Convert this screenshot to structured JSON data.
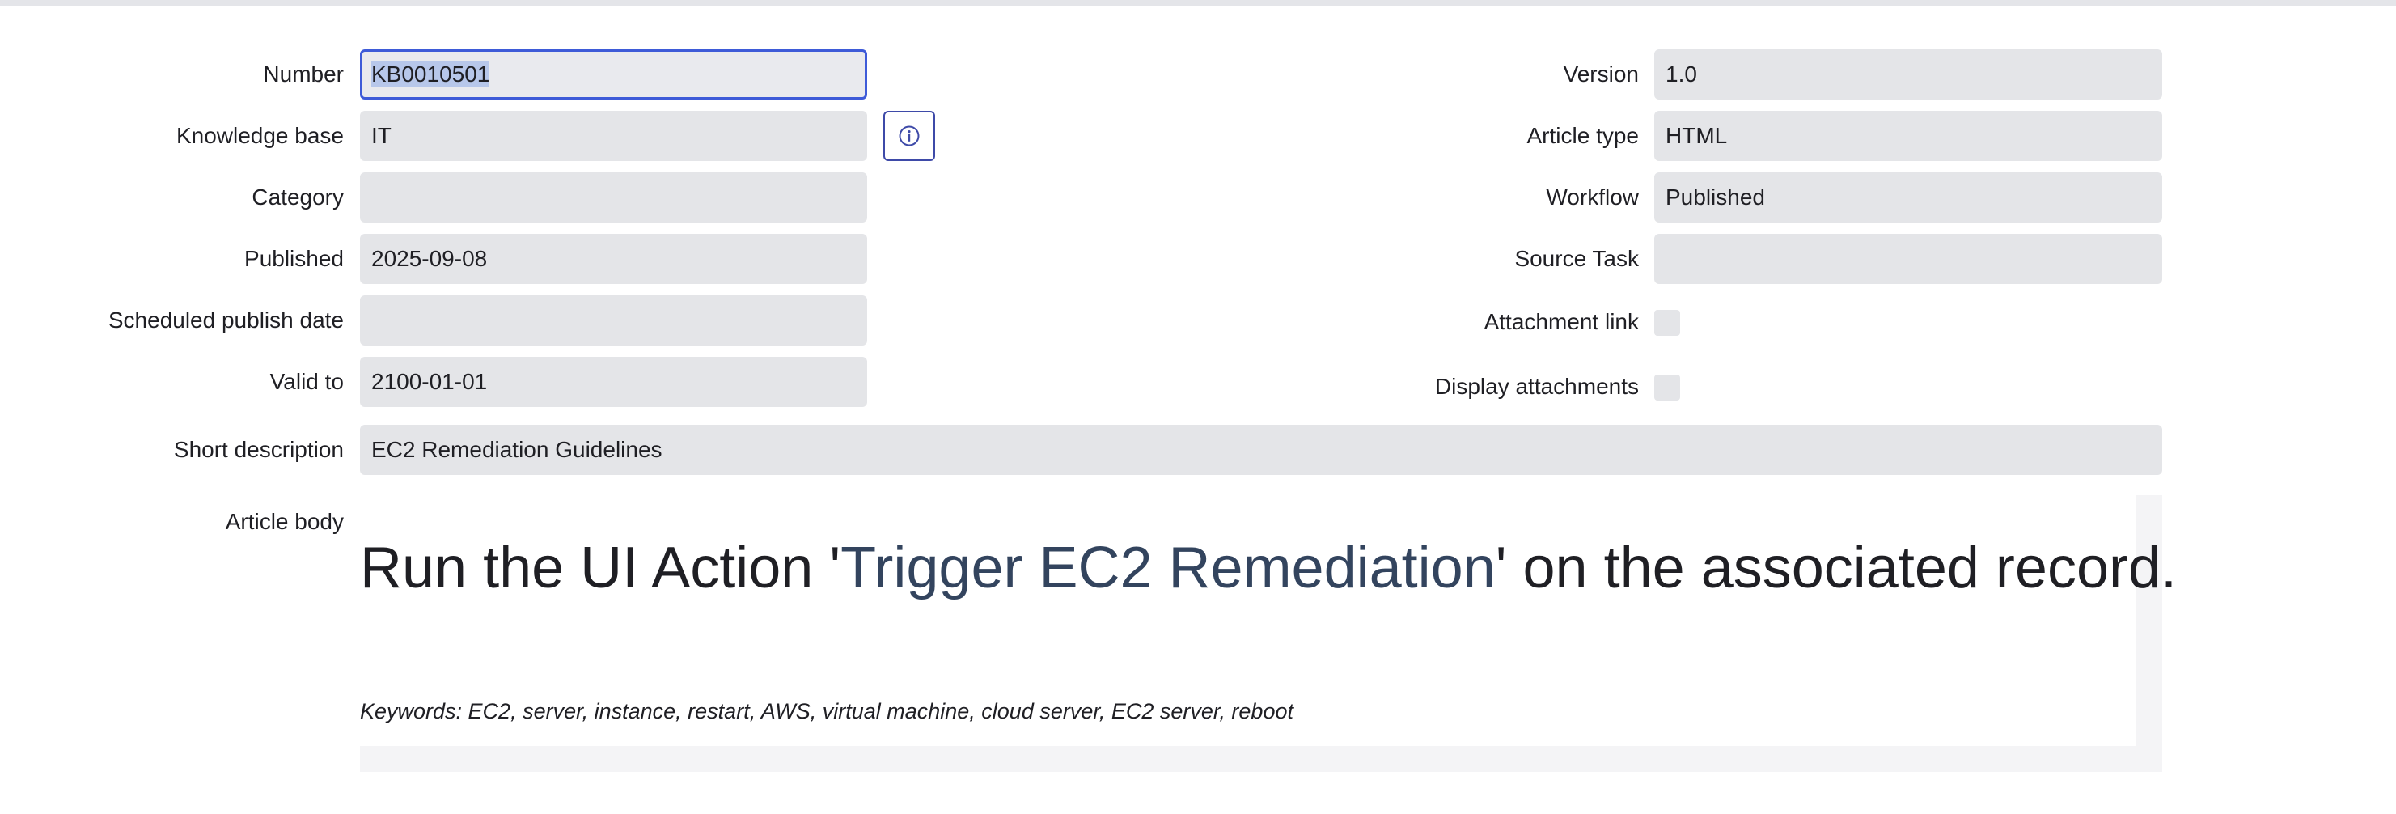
{
  "form": {
    "left": {
      "number": {
        "label": "Number",
        "value": "KB0010501"
      },
      "knowledge_base": {
        "label": "Knowledge base",
        "value": "IT"
      },
      "category": {
        "label": "Category",
        "value": ""
      },
      "published": {
        "label": "Published",
        "value": "2025-09-08"
      },
      "scheduled_publish_date": {
        "label": "Scheduled publish date",
        "value": ""
      },
      "valid_to": {
        "label": "Valid to",
        "value": "2100-01-01"
      }
    },
    "right": {
      "version": {
        "label": "Version",
        "value": "1.0"
      },
      "article_type": {
        "label": "Article type",
        "value": "HTML"
      },
      "workflow": {
        "label": "Workflow",
        "value": "Published"
      },
      "source_task": {
        "label": "Source Task",
        "value": ""
      },
      "attachment_link": {
        "label": "Attachment link",
        "checked": false
      },
      "display_attachments": {
        "label": "Display attachments",
        "checked": false
      }
    },
    "short_description": {
      "label": "Short description",
      "value": "EC2 Remediation Guidelines"
    },
    "article_body": {
      "label": "Article body",
      "heading_pre": "Run the UI Action '",
      "heading_link": "Trigger EC2 Remediation",
      "heading_post": "' on the associated record.",
      "keywords": "Keywords: EC2, server, instance, restart, AWS, virtual machine, cloud server, EC2 server, reboot"
    }
  },
  "icons": {
    "info": "info-circle-icon"
  },
  "colors": {
    "focus_border": "#3e5bd8",
    "field_bg": "#e4e5e8",
    "link": "#33445e",
    "info_icon": "#3e4aa8"
  }
}
